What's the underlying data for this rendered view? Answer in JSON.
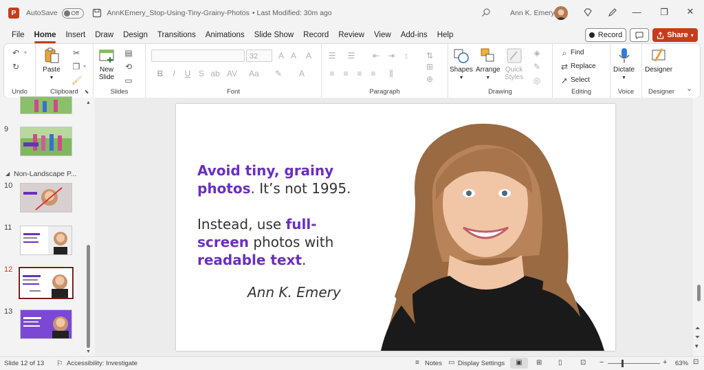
{
  "titlebar": {
    "autosave_label": "AutoSave",
    "autosave_state": "Off",
    "doc_title": "AnnKEmery_Stop-Using-Tiny-Grainy-Photos",
    "modified": "• Last Modified: 30m ago",
    "user_name": "Ann K. Emery"
  },
  "menu": {
    "items": [
      "File",
      "Home",
      "Insert",
      "Draw",
      "Design",
      "Transitions",
      "Animations",
      "Slide Show",
      "Record",
      "Review",
      "View",
      "Add-ins",
      "Help"
    ],
    "active": "Home",
    "record_label": "Record",
    "share_label": "Share"
  },
  "ribbon": {
    "groups": {
      "undo": "Undo",
      "clipboard": "Clipboard",
      "slides": "Slides",
      "font": "Font",
      "paragraph": "Paragraph",
      "drawing": "Drawing",
      "editing": "Editing",
      "voice": "Voice",
      "designer": "Designer"
    },
    "paste_label": "Paste",
    "new_slide_label_1": "New",
    "new_slide_label_2": "Slide",
    "font_size": "32",
    "shapes_label": "Shapes",
    "arrange_label": "Arrange",
    "quick_styles_1": "Quick",
    "quick_styles_2": "Styles",
    "find_label": "Find",
    "replace_label": "Replace",
    "select_label": "Select",
    "dictate_label": "Dictate",
    "designer_label": "Designer"
  },
  "slides_pane": {
    "section_label": "Non-Landscape P...",
    "numbers": [
      "9",
      "10",
      "11",
      "12",
      "13"
    ],
    "selected": "12"
  },
  "slide": {
    "line1_a": "Avoid tiny, grainy",
    "line2_a": "photos",
    "line2_b": ". It’s not 1995.",
    "line3_a": "Instead, use ",
    "line3_b": "full-",
    "line4_a": "screen",
    "line4_b": " photos with",
    "line5_a": "readable text",
    "line5_b": ".",
    "signature": "Ann K. Emery"
  },
  "status": {
    "slide_of": "Slide 12 of 13",
    "accessibility": "Accessibility: Investigate",
    "notes": "Notes",
    "display_settings": "Display Settings",
    "zoom": "63%"
  },
  "colors": {
    "accent": "#c43e1c",
    "slide_purple": "#6a2fbf"
  }
}
